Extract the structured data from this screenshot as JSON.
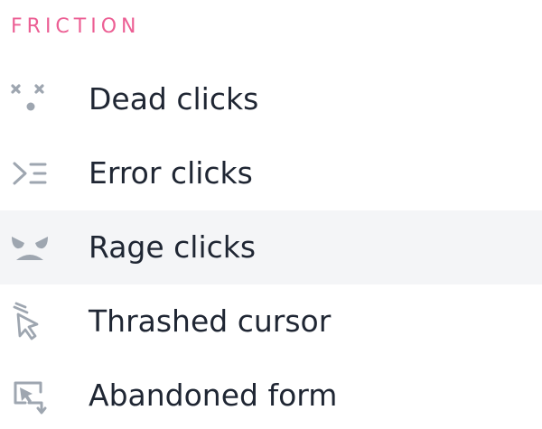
{
  "section": {
    "title": "FRICTION"
  },
  "colors": {
    "title": "#ec5f94",
    "icon": "#9ea6b0",
    "label": "#1f2633",
    "highlight_bg": "#f4f5f7"
  },
  "items": [
    {
      "label": "Dead clicks",
      "icon": "dead-clicks-icon"
    },
    {
      "label": "Error clicks",
      "icon": "error-clicks-icon"
    },
    {
      "label": "Rage clicks",
      "icon": "rage-clicks-icon",
      "highlighted": true
    },
    {
      "label": "Thrashed cursor",
      "icon": "thrashed-cursor-icon"
    },
    {
      "label": "Abandoned form",
      "icon": "abandoned-form-icon"
    }
  ]
}
